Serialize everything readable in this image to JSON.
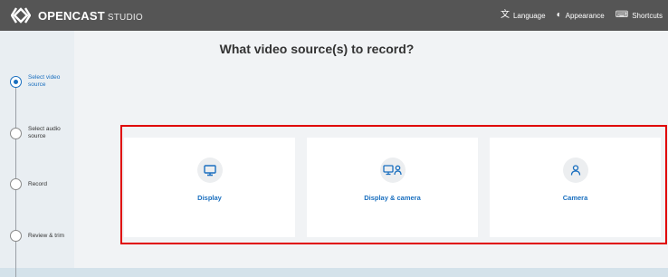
{
  "app": {
    "brand": "OPENCAST",
    "brand_sub": "STUDIO"
  },
  "nav": [
    {
      "icon": "language-icon",
      "glyph": "文",
      "label": "Language"
    },
    {
      "icon": "appearance-icon",
      "glyph": "◐",
      "label": "Appearance"
    },
    {
      "icon": "keyboard-icon",
      "glyph": "⌨",
      "label": "Shortcuts"
    }
  ],
  "steps": [
    {
      "label": "Select video source",
      "active": true
    },
    {
      "label": "Select audio source",
      "active": false
    },
    {
      "label": "Record",
      "active": false
    },
    {
      "label": "Review & trim",
      "active": false
    }
  ],
  "main": {
    "title": "What video source(s) to record?"
  },
  "sources": [
    {
      "label": "Display",
      "icon": "monitor-icon"
    },
    {
      "label": "Display & camera",
      "icon": "monitor-person-icon"
    },
    {
      "label": "Camera",
      "icon": "person-icon"
    }
  ],
  "colors": {
    "accent": "#1a6fbf",
    "topbar": "#555555",
    "highlight": "#e00000"
  }
}
